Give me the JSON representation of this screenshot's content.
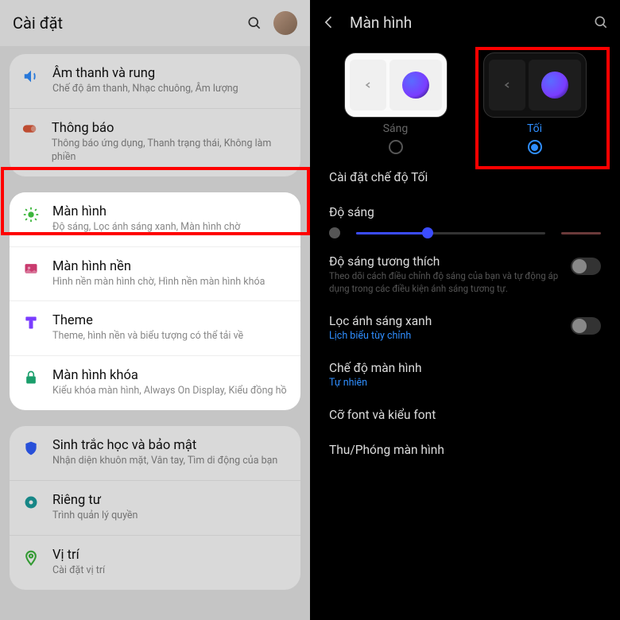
{
  "left": {
    "title": "Cài đặt",
    "items": [
      {
        "label": "Âm thanh và rung",
        "sub": "Chế độ âm thanh, Nhạc chuông, Âm lượng",
        "icon": "volume-icon",
        "color": "#2f8eff"
      },
      {
        "label": "Thông báo",
        "sub": "Thông báo ứng dụng, Thanh trạng thái, Không làm phiền",
        "icon": "notification-icon",
        "color": "#e05a3a"
      }
    ],
    "highlight": {
      "label": "Màn hình",
      "sub": "Độ sáng, Lọc ánh sáng xanh, Màn hình chờ",
      "icon": "brightness-icon",
      "color": "#3cb63c"
    },
    "items2": [
      {
        "label": "Màn hình nền",
        "sub": "Hình nền màn hình chờ, Hình nền màn hình khóa",
        "icon": "wallpaper-icon",
        "color": "#c93a6e"
      },
      {
        "label": "Theme",
        "sub": "Theme, hình nền và biểu tượng có thể tải về",
        "icon": "theme-icon",
        "color": "#7a3cff"
      },
      {
        "label": "Màn hình khóa",
        "sub": "Kiểu khóa màn hình, Always On Display, Kiểu đồng hồ",
        "icon": "lock-icon",
        "color": "#1a9e6b"
      }
    ],
    "items3": [
      {
        "label": "Sinh trắc học và bảo mật",
        "sub": "Nhận diện khuôn mặt, Vân tay, Tìm di động của bạn",
        "icon": "shield-icon",
        "color": "#2f5eff"
      },
      {
        "label": "Riêng tư",
        "sub": "Trình quản lý quyền",
        "icon": "privacy-icon",
        "color": "#1a9e9e"
      },
      {
        "label": "Vị trí",
        "sub": "Cài đặt vị trí",
        "icon": "location-icon",
        "color": "#3cb63c"
      }
    ]
  },
  "right": {
    "title": "Màn hình",
    "mode_light": "Sáng",
    "mode_dark": "Tối",
    "dark_settings": "Cài đặt chế độ Tối",
    "brightness": "Độ sáng",
    "adaptive": {
      "label": "Độ sáng tương thích",
      "desc": "Theo dõi cách điều chỉnh độ sáng của bạn và tự động áp dụng trong các điều kiện ánh sáng tương tự."
    },
    "bluelight": {
      "label": "Lọc ánh sáng xanh",
      "link": "Lịch biểu tùy chỉnh"
    },
    "screenmode": {
      "label": "Chế độ màn hình",
      "link": "Tự nhiên"
    },
    "font": "Cỡ font và kiểu font",
    "zoom": "Thu/Phóng màn hình"
  }
}
